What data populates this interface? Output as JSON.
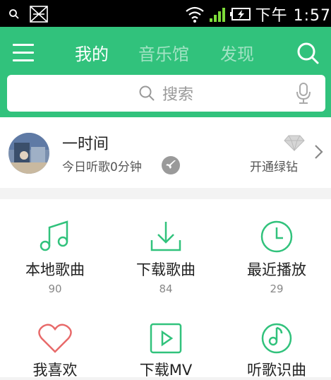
{
  "status_bar": {
    "time": "下午 1:57",
    "icons": [
      "search-icon",
      "usb-debug-icon",
      "wifi-icon",
      "signal-icon",
      "battery-charging-icon"
    ]
  },
  "colors": {
    "accent": "#31c27c",
    "icon_green": "#31c27c",
    "heart_red": "#e86a6a"
  },
  "top_bar": {
    "tabs": [
      {
        "label": "我的",
        "active": true
      },
      {
        "label": "音乐馆",
        "active": false
      },
      {
        "label": "发现",
        "active": false
      }
    ]
  },
  "search": {
    "placeholder": "搜索"
  },
  "profile": {
    "name": "一时间",
    "listen_today": "今日听歌0分钟",
    "vip_link": "开通绿钻"
  },
  "grid": [
    {
      "label": "本地歌曲",
      "count": "90",
      "icon": "music-note-icon"
    },
    {
      "label": "下载歌曲",
      "count": "84",
      "icon": "download-icon"
    },
    {
      "label": "最近播放",
      "count": "29",
      "icon": "clock-icon"
    },
    {
      "label": "我喜欢",
      "count": "",
      "icon": "heart-icon"
    },
    {
      "label": "下载MV",
      "count": "",
      "icon": "play-video-icon"
    },
    {
      "label": "听歌识曲",
      "count": "",
      "icon": "music-recognition-icon"
    }
  ]
}
